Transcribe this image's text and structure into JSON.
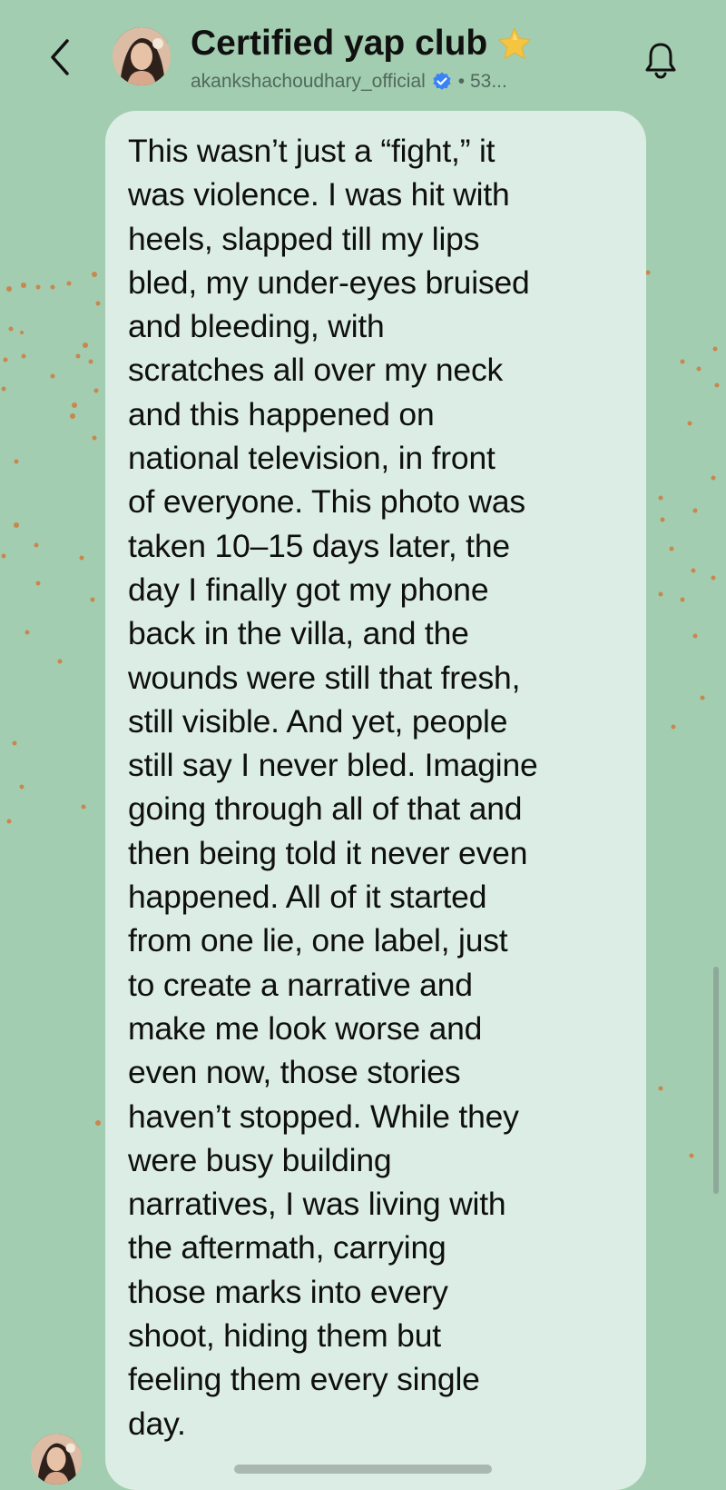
{
  "header": {
    "back_icon": "chevron-left-icon",
    "title": "Certified yap club",
    "title_emoji": "star-icon",
    "subtitle_handle": "akankshachoudhary_official",
    "verified_icon": "verified-badge-icon",
    "subtitle_suffix": "• 53...",
    "bell_icon": "bell-icon"
  },
  "message": {
    "text": "This wasn’t just a “fight,” it\nwas violence. I was hit with\nheels, slapped till my lips\nbled, my under-eyes bruised\nand bleeding, with\nscratches all over my neck\nand this happened on\nnational television, in front\nof everyone. This photo was\ntaken 10–15 days later, the\nday I finally got my phone\nback in the villa, and the\nwounds were still that fresh,\nstill visible. And yet, people\nstill say I never bled. Imagine\ngoing through all of that and\nthen being told it never even\nhappened. All of it started\nfrom one lie, one label, just\nto create a narrative and\nmake me look worse and\neven now, those stories\nhaven’t stopped. While they\nwere busy building\nnarratives, I was living with\nthe aftermath, carrying\nthose marks into every\nshoot, hiding them but\nfeeling them every single\nday."
  },
  "colors": {
    "background": "#a3cdb0",
    "bubble": "#dbede4",
    "verified": "#3b82f6",
    "star": "#f5c542"
  }
}
